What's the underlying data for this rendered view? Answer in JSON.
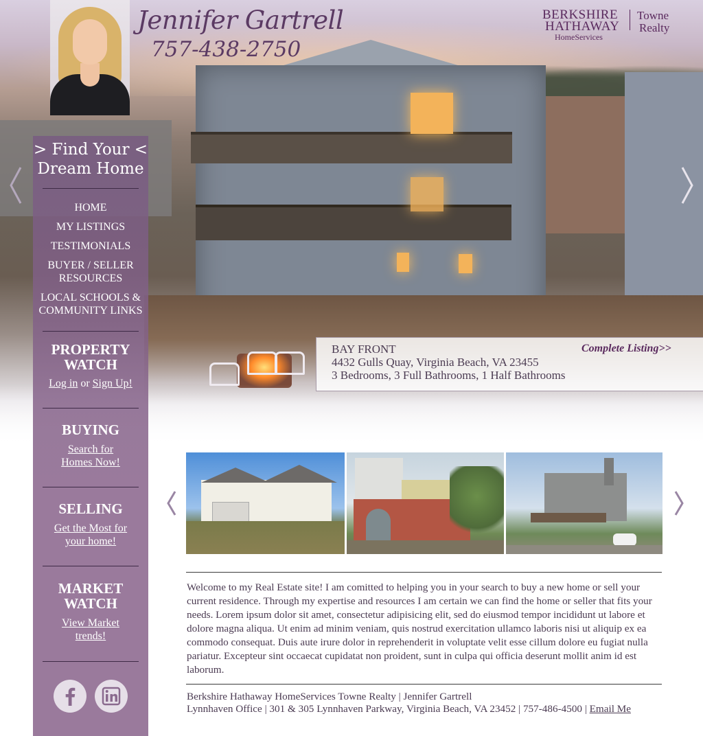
{
  "header": {
    "agent_name": "Jennifer Gartrell",
    "agent_phone": "757-438-2750",
    "brand": {
      "line1": "BERKSHIRE",
      "line2": "HATHAWAY",
      "line3": "HomeServices",
      "partner_line1": "Towne",
      "partner_line2": "Realty",
      "color": "#5a2a5e"
    }
  },
  "sidebar": {
    "title_line1": "> Find Your <",
    "title_line2": "Dream Home",
    "nav": [
      {
        "label": "HOME"
      },
      {
        "label": "MY LISTINGS"
      },
      {
        "label": "TESTIMONIALS"
      },
      {
        "label": "BUYER / SELLER RESOURCES"
      },
      {
        "label": "LOCAL SCHOOLS & COMMUNITY LINKS"
      }
    ],
    "property_watch": {
      "heading": "PROPERTY WATCH",
      "login_label": "Log in",
      "or_text": "or",
      "signup_label": "Sign Up!"
    },
    "buying": {
      "heading": "BUYING",
      "link": "Search for Homes Now!"
    },
    "selling": {
      "heading": "SELLING",
      "link": "Get the Most for your home!"
    },
    "market_watch": {
      "heading": "MARKET WATCH",
      "link": "View Market trends!"
    },
    "social": [
      {
        "icon": "facebook-icon"
      },
      {
        "icon": "linkedin-icon"
      }
    ],
    "background": "#8a6a8e"
  },
  "listing": {
    "type": "BAY FRONT",
    "address": "4432 Gulls Quay, Virginia Beach, VA 23455",
    "rooms": "3 Bedrooms, 3 Full Bathrooms, 1 Half Bathrooms",
    "link_label": "Complete Listing>>"
  },
  "hero": {
    "prev_icon": "chevron-left-icon",
    "next_icon": "chevron-right-icon"
  },
  "thumbnails": {
    "prev_icon": "chevron-left-icon",
    "next_icon": "chevron-right-icon",
    "items": [
      {
        "name": "listing-thumb-1"
      },
      {
        "name": "listing-thumb-2"
      },
      {
        "name": "listing-thumb-3"
      }
    ]
  },
  "welcome_text": "Welcome to my Real Estate site! I am comitted to helping you in your search to buy a new home or sell your current residence. Through my expertise and resources I am certain we can find the home or seller that fits your needs. Lorem ipsum dolor sit amet, consectetur adipisicing elit, sed do eiusmod tempor incididunt ut labore et dolore magna aliqua. Ut enim ad minim veniam, quis nostrud exercitation ullamco laboris nisi ut aliquip ex ea commodo consequat. Duis aute irure dolor in reprehenderit in voluptate velit esse cillum dolore eu fugiat nulla pariatur. Excepteur sint occaecat cupidatat non proident, sunt in culpa qui officia deserunt mollit anim id est laborum.",
  "footer": {
    "line1": "Berkshire Hathaway HomeServices Towne Realty | Jennifer Gartrell",
    "line2_prefix": "Lynnhaven Office | 301 & 305 Lynnhaven Parkway, Virginia Beach, VA 23452 | 757-486-4500 |",
    "email_label": "Email Me"
  }
}
